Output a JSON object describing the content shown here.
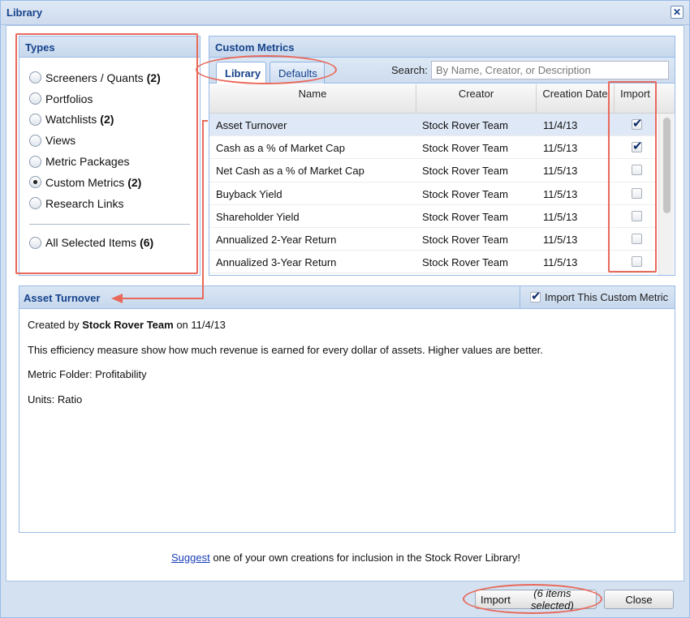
{
  "window": {
    "title": "Library",
    "close_icon": "close-icon"
  },
  "types": {
    "header": "Types",
    "items": [
      {
        "label": "Screeners / Quants",
        "count": "(2)",
        "selected": false
      },
      {
        "label": "Portfolios",
        "count": "",
        "selected": false
      },
      {
        "label": "Watchlists",
        "count": "(2)",
        "selected": false
      },
      {
        "label": "Views",
        "count": "",
        "selected": false
      },
      {
        "label": "Metric Packages",
        "count": "",
        "selected": false
      },
      {
        "label": "Custom Metrics",
        "count": "(2)",
        "selected": true
      },
      {
        "label": "Research Links",
        "count": "",
        "selected": false
      }
    ],
    "all_selected": {
      "label": "All Selected Items",
      "count": "(6)"
    }
  },
  "custom_metrics": {
    "header": "Custom Metrics",
    "tabs": [
      {
        "label": "Library",
        "active": true
      },
      {
        "label": "Defaults",
        "active": false
      }
    ],
    "search": {
      "label": "Search:",
      "placeholder": "By Name, Creator, or Description",
      "value": ""
    },
    "columns": [
      "Name",
      "Creator",
      "Creation Date",
      "Import"
    ],
    "rows": [
      {
        "name": "Asset Turnover",
        "creator": "Stock Rover Team",
        "date": "11/4/13",
        "import": true,
        "selected": true
      },
      {
        "name": "Cash as a % of Market Cap",
        "creator": "Stock Rover Team",
        "date": "11/5/13",
        "import": true,
        "selected": false
      },
      {
        "name": "Net Cash as a % of Market Cap",
        "creator": "Stock Rover Team",
        "date": "11/5/13",
        "import": false,
        "selected": false
      },
      {
        "name": "Buyback Yield",
        "creator": "Stock Rover Team",
        "date": "11/5/13",
        "import": false,
        "selected": false
      },
      {
        "name": "Shareholder Yield",
        "creator": "Stock Rover Team",
        "date": "11/5/13",
        "import": false,
        "selected": false
      },
      {
        "name": "Annualized 2-Year Return",
        "creator": "Stock Rover Team",
        "date": "11/5/13",
        "import": false,
        "selected": false
      },
      {
        "name": "Annualized 3-Year Return",
        "creator": "Stock Rover Team",
        "date": "11/5/13",
        "import": false,
        "selected": false
      }
    ]
  },
  "detail": {
    "title": "Asset Turnover",
    "import_toggle_label": "Import This Custom Metric",
    "import_checked": true,
    "created_prefix": "Created by",
    "created_by": "Stock Rover Team",
    "created_on": "on 11/4/13",
    "description": "This efficiency measure show how much revenue is earned for every dollar of assets. Higher values are better.",
    "folder": "Metric Folder: Profitability",
    "units": "Units: Ratio"
  },
  "suggest": {
    "link_text": "Suggest",
    "rest": " one of your own creations for inclusion in the Stock Rover Library!"
  },
  "footer": {
    "import_label": "Import",
    "import_detail": "(6 items selected)",
    "close_label": "Close"
  },
  "colors": {
    "accent": "#15428b",
    "highlight": "#e9695a",
    "selected_row": "#dfe8f6"
  }
}
